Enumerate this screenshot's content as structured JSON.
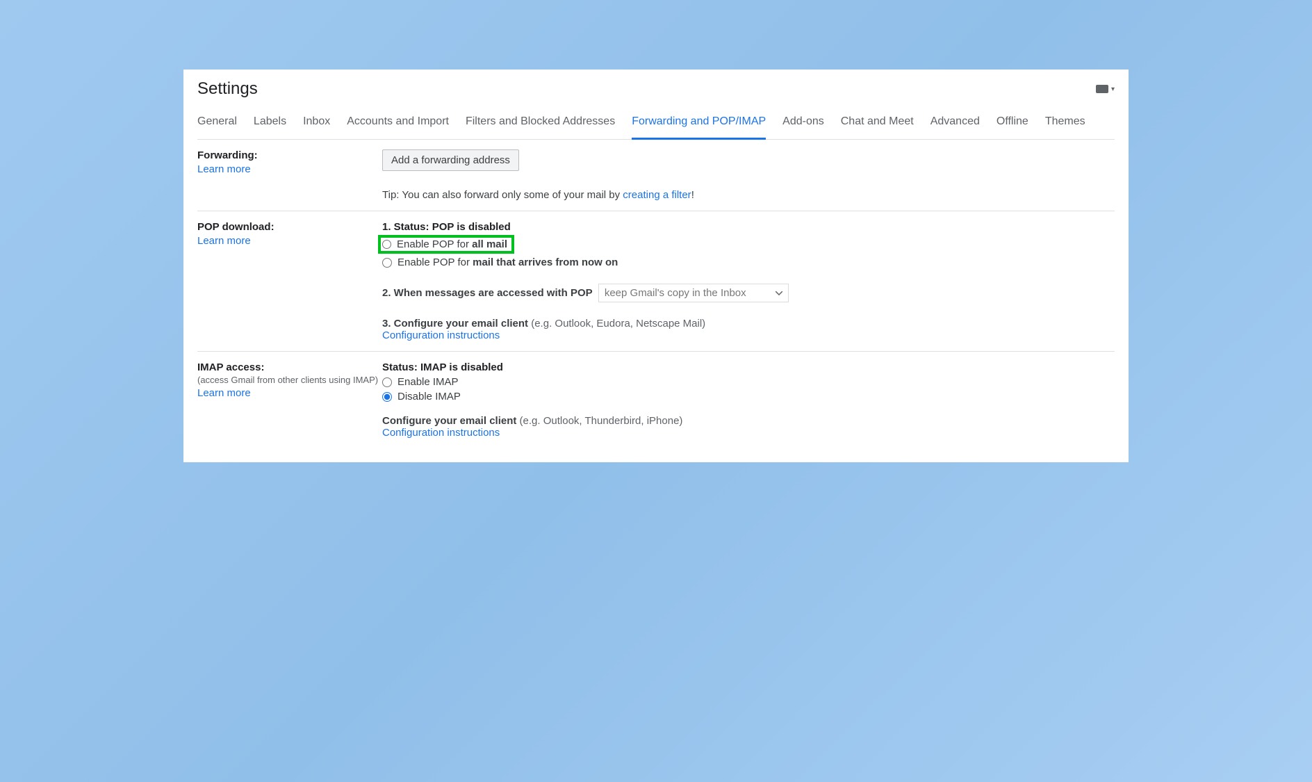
{
  "title": "Settings",
  "tabs": [
    "General",
    "Labels",
    "Inbox",
    "Accounts and Import",
    "Filters and Blocked Addresses",
    "Forwarding and POP/IMAP",
    "Add-ons",
    "Chat and Meet",
    "Advanced",
    "Offline",
    "Themes"
  ],
  "activeTab": "Forwarding and POP/IMAP",
  "learnMore": "Learn more",
  "forwarding": {
    "heading": "Forwarding:",
    "button": "Add a forwarding address",
    "tipPrefix": "Tip: You can also forward only some of your mail by ",
    "tipLink": "creating a filter",
    "tipSuffix": "!"
  },
  "pop": {
    "heading": "POP download:",
    "statusPrefix": "1. Status: ",
    "statusValue": "POP is disabled",
    "opt1a": "Enable POP for ",
    "opt1b": "all mail",
    "opt2a": "Enable POP for ",
    "opt2b": "mail that arrives from now on",
    "step2a": "2. When messages are accessed with POP",
    "step2select": "keep Gmail's copy in the Inbox",
    "step3a": "3. Configure your email client ",
    "step3b": "(e.g. Outlook, Eudora, Netscape Mail)",
    "configLink": "Configuration instructions"
  },
  "imap": {
    "heading": "IMAP access:",
    "sub": "(access Gmail from other clients using IMAP)",
    "statusPrefix": "Status: ",
    "statusValue": "IMAP is disabled",
    "opt1": "Enable IMAP",
    "opt2": "Disable IMAP",
    "confA": "Configure your email client ",
    "confB": "(e.g. Outlook, Thunderbird, iPhone)",
    "configLink": "Configuration instructions"
  }
}
